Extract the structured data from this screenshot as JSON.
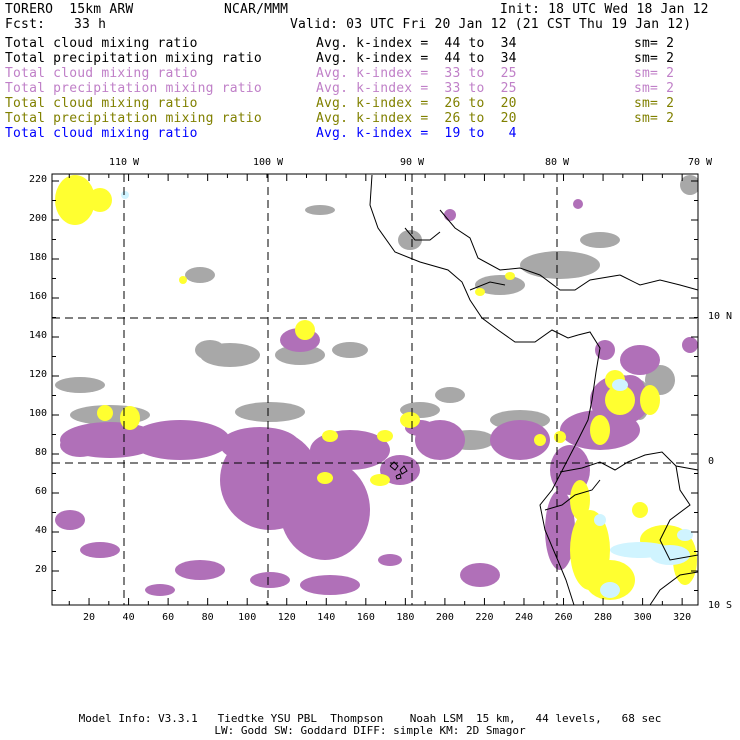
{
  "header": {
    "model": "TORERO  15km ARW",
    "org": "NCAR/MMM",
    "init": "Init: 18 UTC Wed 18 Jan 12",
    "fcst_label": "Fcst:",
    "fcst_value": "33 h",
    "valid": "Valid: 03 UTC Fri 20 Jan 12 (21 CST Thu 19 Jan 12)"
  },
  "legend": [
    {
      "field": "Total cloud mixing ratio",
      "range": "Avg. k-index =  44 to  34",
      "sm": "sm= 2",
      "color": "#000000"
    },
    {
      "field": "Total precipitation mixing ratio",
      "range": "Avg. k-index =  44 to  34",
      "sm": "sm= 2",
      "color": "#000000"
    },
    {
      "field": "Total cloud mixing ratio",
      "range": "Avg. k-index =  33 to  25",
      "sm": "sm= 2",
      "color": "#c080c8"
    },
    {
      "field": "Total precipitation mixing ratio",
      "range": "Avg. k-index =  33 to  25",
      "sm": "sm= 2",
      "color": "#c080c8"
    },
    {
      "field": "Total cloud mixing ratio",
      "range": "Avg. k-index =  26 to  20",
      "sm": "sm= 2",
      "color": "#808000"
    },
    {
      "field": "Total precipitation mixing ratio",
      "range": "Avg. k-index =  26 to  20",
      "sm": "sm= 2",
      "color": "#808000"
    },
    {
      "field": "Total cloud mixing ratio",
      "range": "Avg. k-index =  19 to   4",
      "sm": "",
      "color": "#0000ff"
    }
  ],
  "map": {
    "top_labels": [
      "110 W",
      "100 W",
      "90 W",
      "80 W",
      "70 W"
    ],
    "right_labels": [
      "10 N",
      "0",
      "10 S"
    ],
    "x_ticks": [
      "20",
      "40",
      "60",
      "80",
      "100",
      "120",
      "140",
      "160",
      "180",
      "200",
      "220",
      "240",
      "260",
      "280",
      "300",
      "320"
    ],
    "y_ticks": [
      "220",
      "200",
      "180",
      "160",
      "140",
      "120",
      "100",
      "80",
      "60",
      "40",
      "20"
    ],
    "colors": {
      "gray": "#a8a8a8",
      "purple": "#b070b8",
      "yellow": "#ffff30",
      "lightblue": "#d0f4ff"
    }
  },
  "footer": {
    "line1": "Model Info: V3.3.1   Tiedtke YSU PBL  Thompson    Noah LSM  15 km,   44 levels,   68 sec",
    "line2": "LW: Godd SW: Goddard DIFF: simple KM: 2D Smagor"
  }
}
